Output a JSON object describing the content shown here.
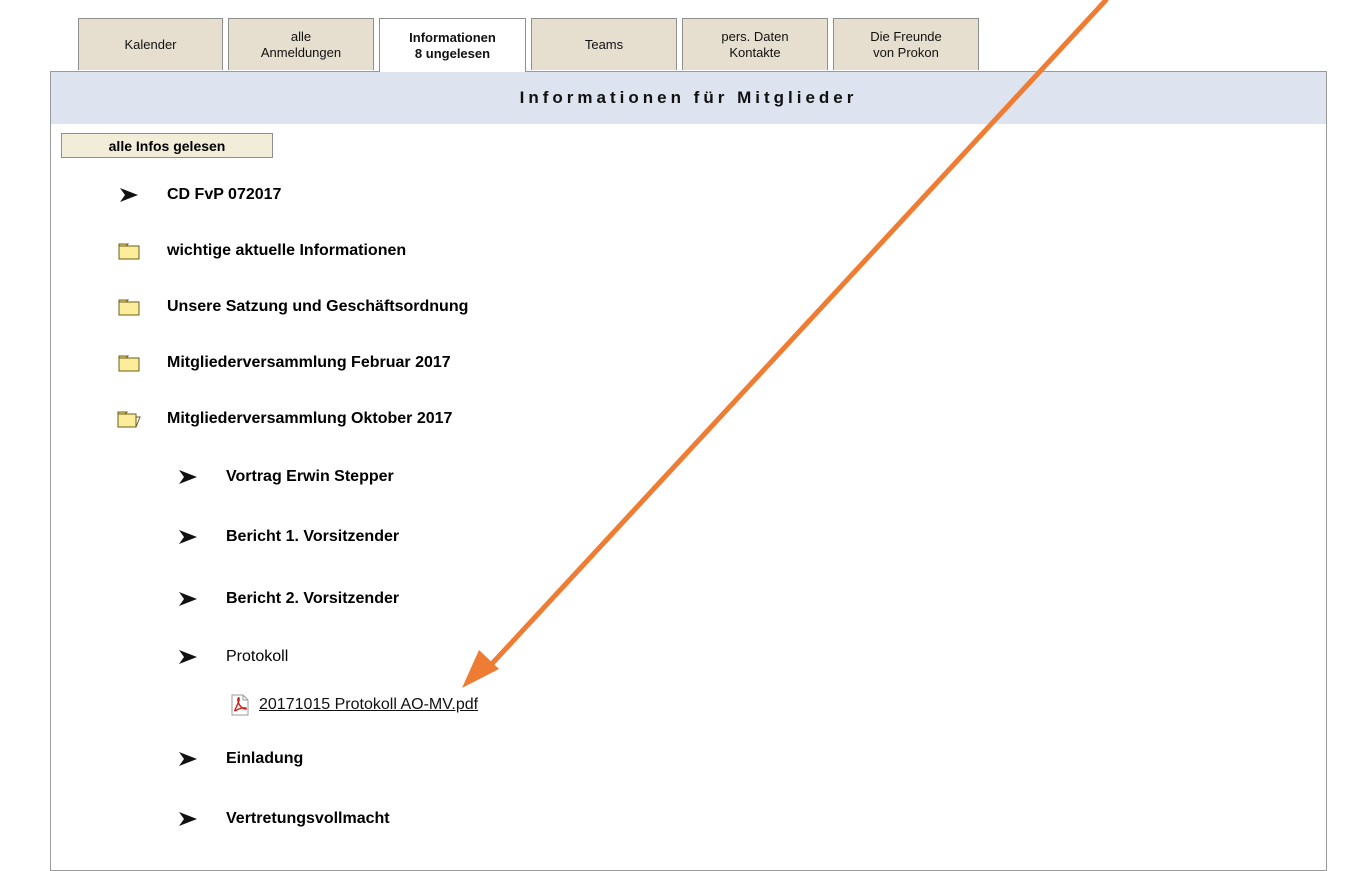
{
  "tabs": [
    {
      "line1": "Kalender",
      "line2": ""
    },
    {
      "line1": "alle",
      "line2": "Anmeldungen"
    },
    {
      "line1": "Informationen",
      "line2": "8 ungelesen"
    },
    {
      "line1": "Teams",
      "line2": ""
    },
    {
      "line1": "pers. Daten",
      "line2": "Kontakte"
    },
    {
      "line1": "Die Freunde",
      "line2": "von Prokon"
    }
  ],
  "active_tab": "Informationen",
  "header": {
    "title": "Informationen für Mitglieder"
  },
  "read_all_button": "alle Infos gelesen",
  "items": {
    "cd": "CD FvP 072017",
    "wichtige": "wichtige aktuelle Informationen",
    "satzung": "Unsere Satzung und Geschäftsordnung",
    "mv_feb": "Mitgliederversammlung Februar 2017",
    "mv_okt": "Mitgliederversammlung Oktober 2017",
    "vortrag": "Vortrag Erwin Stepper",
    "bericht1": "Bericht 1. Vorsitzender",
    "bericht2": "Bericht 2. Vorsitzender",
    "protokoll": "Protokoll",
    "protokoll_file": "20171015 Protokoll AO-MV.pdf",
    "einladung": "Einladung",
    "vollmacht": "Vertretungsvollmacht"
  },
  "colors": {
    "annotation_arrow": "#ee7d33",
    "header_bg": "#dde4f0",
    "tab_bg": "#e6dfcf"
  },
  "icons": {
    "bullet": "arrow-bullet-icon",
    "folder": "folder-icon",
    "folder_open": "folder-open-icon",
    "pdf": "pdf-icon"
  }
}
